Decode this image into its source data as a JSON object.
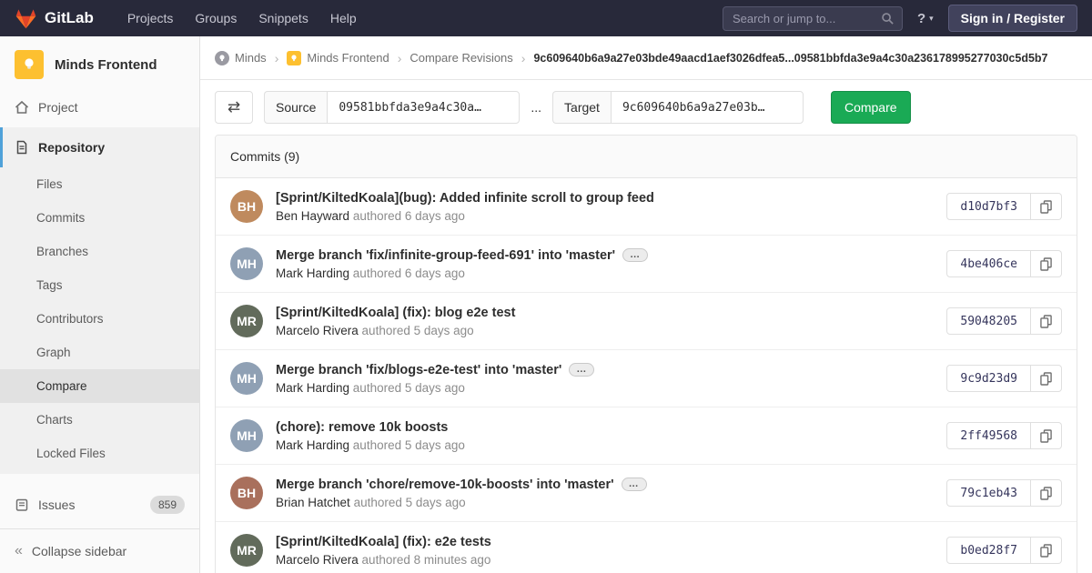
{
  "navbar": {
    "brand": "GitLab",
    "items": [
      {
        "label": "Projects"
      },
      {
        "label": "Groups"
      },
      {
        "label": "Snippets"
      },
      {
        "label": "Help"
      }
    ],
    "search_placeholder": "Search or jump to...",
    "signin_label": "Sign in / Register"
  },
  "sidebar": {
    "project_name": "Minds Frontend",
    "project_item": "Project",
    "repository_item": "Repository",
    "repo_subitems": [
      "Files",
      "Commits",
      "Branches",
      "Tags",
      "Contributors",
      "Graph",
      "Compare",
      "Charts",
      "Locked Files"
    ],
    "issues_label": "Issues",
    "issues_count": "859",
    "collapse_label": "Collapse sidebar"
  },
  "breadcrumb": {
    "items": [
      "Minds",
      "Minds Frontend",
      "Compare Revisions"
    ],
    "current": "9c609640b6a9a27e03bde49aacd1aef3026dfea5...09581bbfda3e9a4c30a236178995277030c5d5b7"
  },
  "compare": {
    "source_label": "Source",
    "source_value": "09581bbfda3e9a4c30a…",
    "separator": "...",
    "target_label": "Target",
    "target_value": "9c609640b6a9a27e03b…",
    "button_label": "Compare"
  },
  "commits": {
    "header": "Commits (9)",
    "expander_label": "…",
    "list": [
      {
        "title": "[Sprint/KiltedKoala](bug): Added infinite scroll to group feed",
        "author": "Ben Hayward",
        "meta": "authored 6 days ago",
        "sha": "d10d7bf3",
        "initials": "BH"
      },
      {
        "title": "Merge branch 'fix/infinite-group-feed-691' into 'master'",
        "author": "Mark Harding",
        "meta": "authored 6 days ago",
        "sha": "4be406ce",
        "initials": "MH"
      },
      {
        "title": "[Sprint/KiltedKoala] (fix): blog e2e test",
        "author": "Marcelo Rivera",
        "meta": "authored 5 days ago",
        "sha": "59048205",
        "initials": "MR"
      },
      {
        "title": "Merge branch 'fix/blogs-e2e-test' into 'master'",
        "author": "Mark Harding",
        "meta": "authored 5 days ago",
        "sha": "9c9d23d9",
        "initials": "MH"
      },
      {
        "title": "(chore): remove 10k boosts",
        "author": "Mark Harding",
        "meta": "authored 5 days ago",
        "sha": "2ff49568",
        "initials": "MH"
      },
      {
        "title": "Merge branch 'chore/remove-10k-boosts' into 'master'",
        "author": "Brian Hatchet",
        "meta": "authored 5 days ago",
        "sha": "79c1eb43",
        "initials": "BH"
      },
      {
        "title": "[Sprint/KiltedKoala] (fix): e2e tests",
        "author": "Marcelo Rivera",
        "meta": "authored 8 minutes ago",
        "sha": "b0ed28f7",
        "initials": "MR"
      }
    ]
  },
  "colors": {
    "brand_orange": "#e24329",
    "accent_green": "#1aaa55",
    "navbar_bg": "#28293a",
    "active_indicator_blue": "#4fa1d9"
  }
}
